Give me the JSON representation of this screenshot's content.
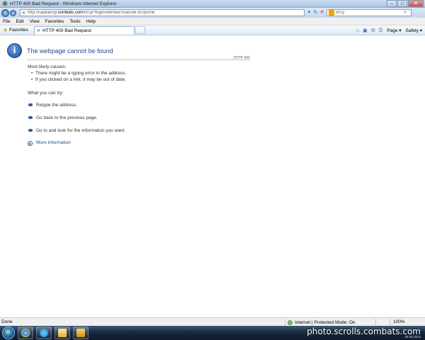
{
  "window": {
    "title": "HTTP 400 Bad Request - Windows Internet Explorer",
    "buttons": {
      "minimize": "‒",
      "maximize": "□",
      "close": "✕"
    }
  },
  "address": {
    "url_prefix": "http://capitalcity.",
    "url_domain": "combats.com",
    "url_suffix": "/inf.pl?login=Ветвистоногий острогпи",
    "search_placeholder": "Bing"
  },
  "menu": [
    "File",
    "Edit",
    "View",
    "Favorites",
    "Tools",
    "Help"
  ],
  "favorites": {
    "label": "Favorites",
    "tab_title": "HTTP 400 Bad Request"
  },
  "commandbar": {
    "page": "Page ▾",
    "safety": "Safety ▾"
  },
  "content": {
    "title": "The webpage cannot be found",
    "http_code": "HTTP 400",
    "causes_heading": "Most likely causes:",
    "causes": [
      "There might be a typing error in the address.",
      "If you clicked on a link, it may be out of date."
    ],
    "try_heading": "What you can try:",
    "tasks": [
      "Retype the address.",
      "Go back to the previous page.",
      "Go to  and look for the information you want."
    ],
    "more_info": "More information"
  },
  "status": {
    "text": "Done",
    "zone": "Internet | Protected Mode: On",
    "zoom": "100%"
  },
  "taskbar": {
    "watermark": "photo.scrolls.combats.com",
    "date": "25.05.2012"
  },
  "colors": {
    "link": "#1f4d96",
    "titlebar": "#a9c4e2"
  }
}
